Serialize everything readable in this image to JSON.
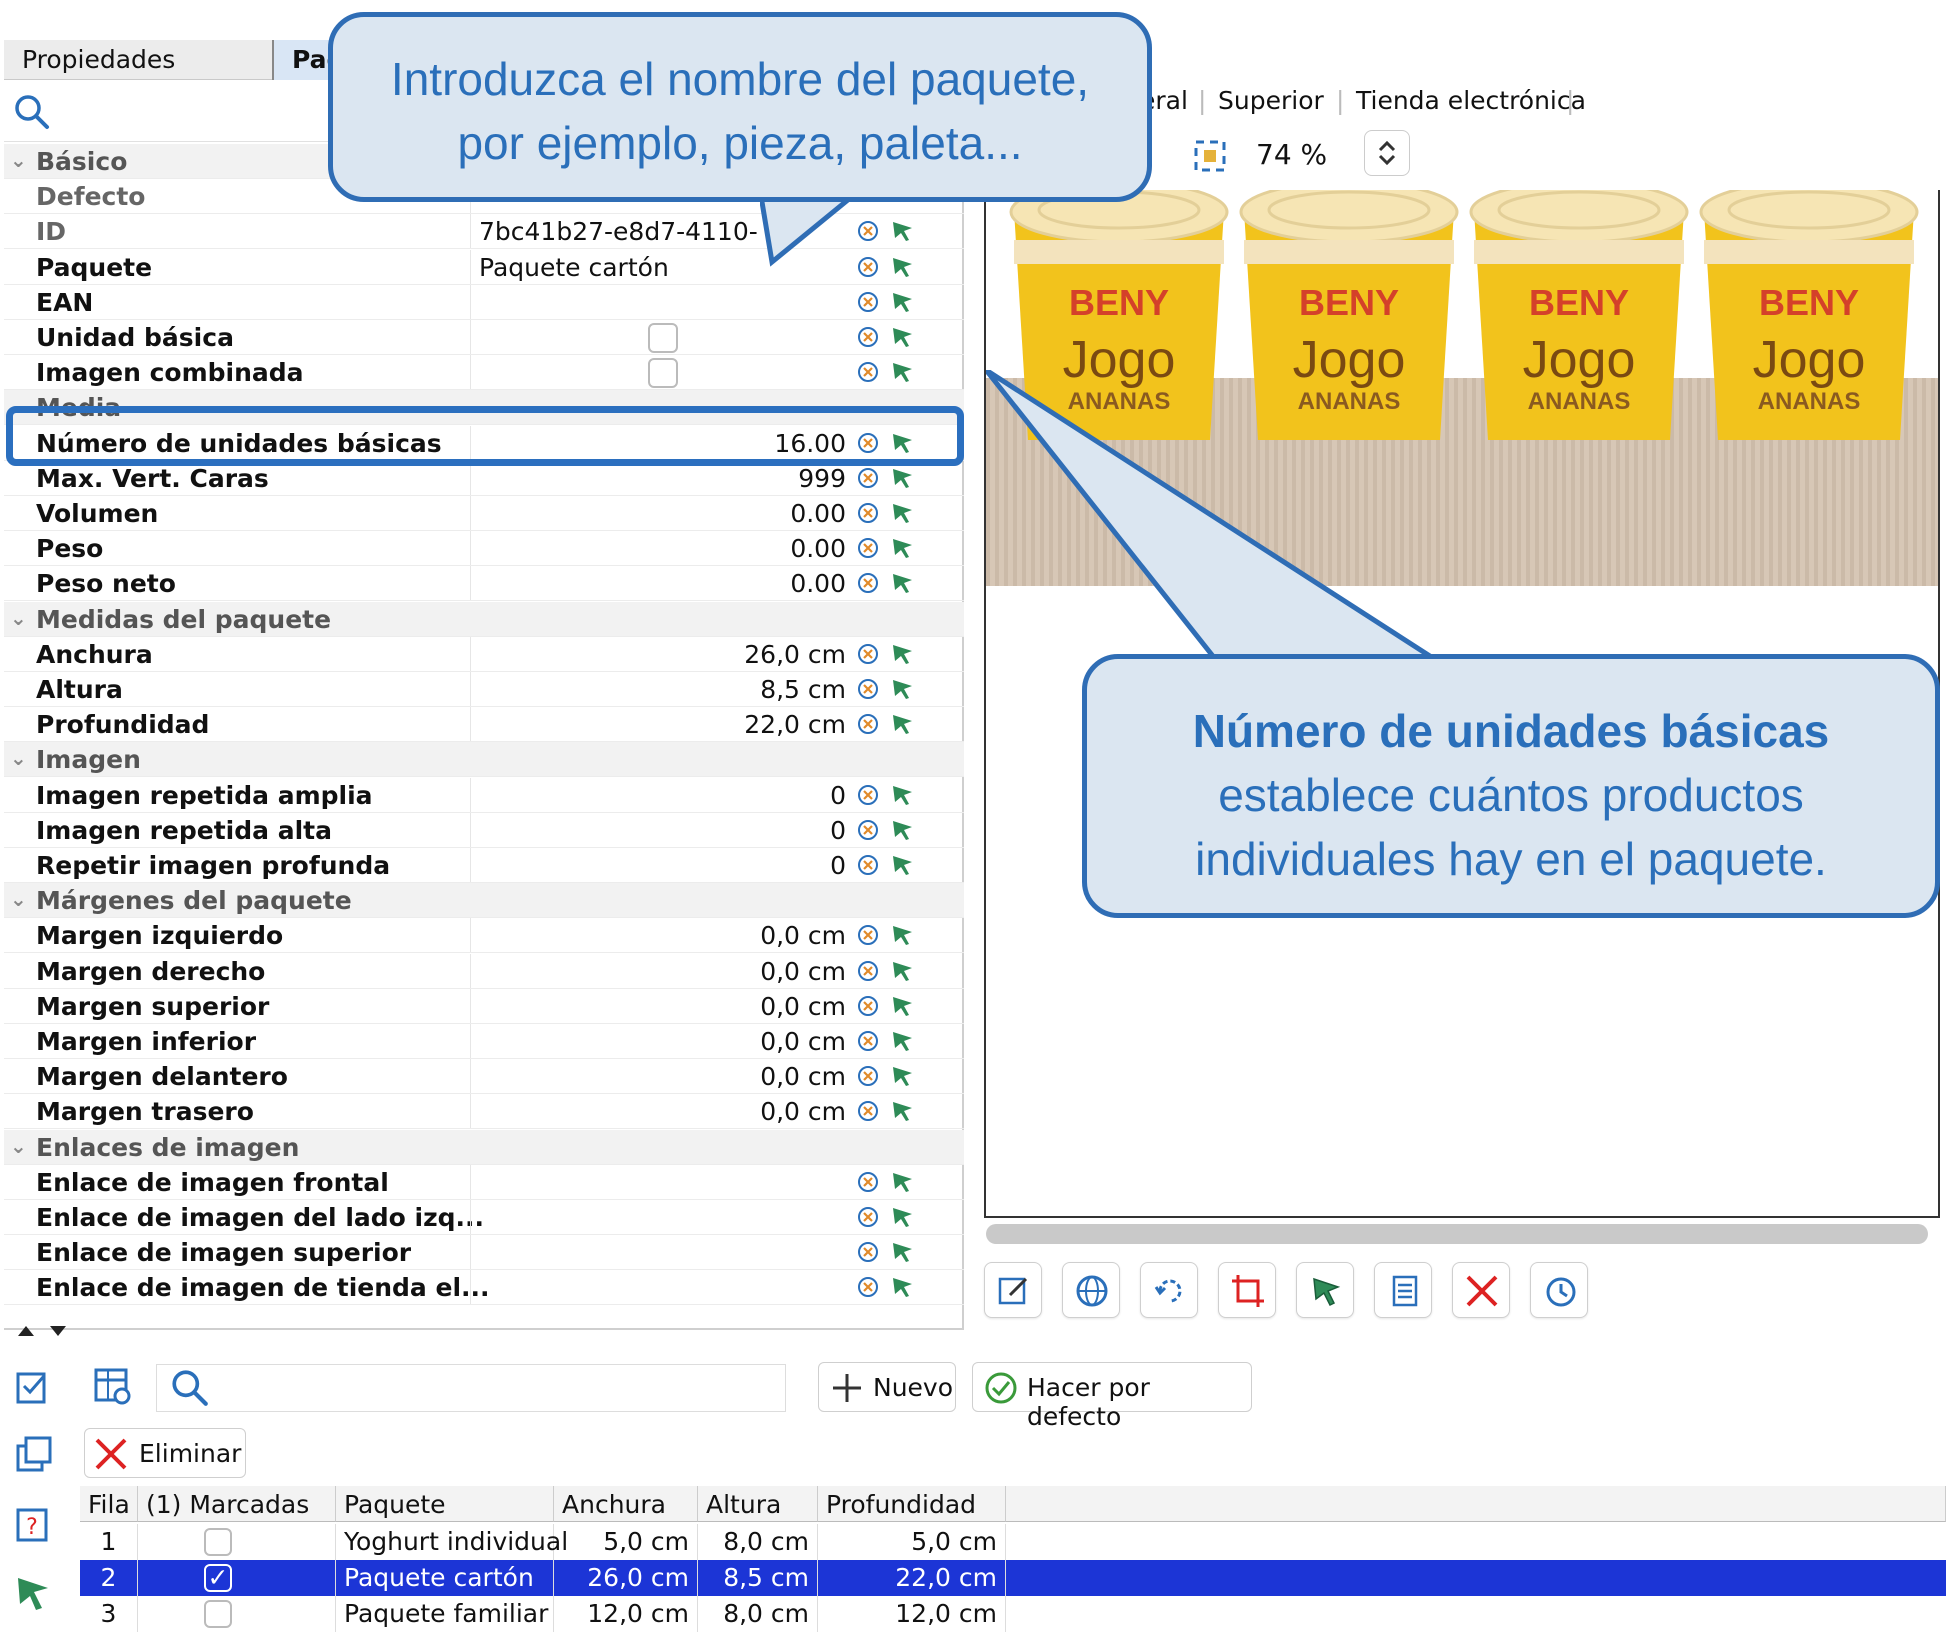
{
  "tabs": {
    "basic": "Propiedades básicas",
    "package": "Paq"
  },
  "properties": [
    {
      "kind": "group",
      "label": "Básico"
    },
    {
      "kind": "row",
      "label": "Defecto",
      "value": "",
      "disabled": true
    },
    {
      "kind": "row",
      "label": "ID",
      "value": "7bc41b27-e8d7-4110-",
      "disabled": true,
      "align": "left"
    },
    {
      "kind": "row",
      "label": "Paquete",
      "value": "Paquete cartón",
      "align": "left"
    },
    {
      "kind": "row",
      "label": "EAN",
      "value": ""
    },
    {
      "kind": "row",
      "label": "Unidad básica",
      "value": "",
      "checkbox": true
    },
    {
      "kind": "row",
      "label": "Imagen combinada",
      "value": "",
      "checkbox": true
    },
    {
      "kind": "group",
      "label": "Media"
    },
    {
      "kind": "row",
      "label": "Número de unidades básicas",
      "value": "16.00"
    },
    {
      "kind": "row",
      "label": "Max. Vert. Caras",
      "value": "999"
    },
    {
      "kind": "row",
      "label": "Volumen",
      "value": "0.00"
    },
    {
      "kind": "row",
      "label": "Peso",
      "value": "0.00"
    },
    {
      "kind": "row",
      "label": "Peso neto",
      "value": "0.00"
    },
    {
      "kind": "group",
      "label": "Medidas del paquete"
    },
    {
      "kind": "row",
      "label": "Anchura",
      "value": "26,0 cm"
    },
    {
      "kind": "row",
      "label": "Altura",
      "value": "8,5 cm"
    },
    {
      "kind": "row",
      "label": "Profundidad",
      "value": "22,0 cm"
    },
    {
      "kind": "group",
      "label": "Imagen"
    },
    {
      "kind": "row",
      "label": "Imagen repetida amplia",
      "value": "0"
    },
    {
      "kind": "row",
      "label": "Imagen repetida alta",
      "value": "0"
    },
    {
      "kind": "row",
      "label": "Repetir imagen profunda",
      "value": "0"
    },
    {
      "kind": "group",
      "label": "Márgenes del paquete"
    },
    {
      "kind": "row",
      "label": "Margen izquierdo",
      "value": "0,0 cm"
    },
    {
      "kind": "row",
      "label": "Margen derecho",
      "value": "0,0 cm"
    },
    {
      "kind": "row",
      "label": "Margen superior",
      "value": "0,0 cm"
    },
    {
      "kind": "row",
      "label": "Margen inferior",
      "value": "0,0 cm"
    },
    {
      "kind": "row",
      "label": "Margen delantero",
      "value": "0,0 cm"
    },
    {
      "kind": "row",
      "label": "Margen trasero",
      "value": "0,0 cm"
    },
    {
      "kind": "group",
      "label": "Enlaces de imagen"
    },
    {
      "kind": "row",
      "label": "Enlace de imagen frontal",
      "value": ""
    },
    {
      "kind": "row",
      "label": "Enlace de imagen del lado izq...",
      "value": ""
    },
    {
      "kind": "row",
      "label": "Enlace de imagen superior",
      "value": ""
    },
    {
      "kind": "row",
      "label": "Enlace de imagen de tienda el...",
      "value": ""
    }
  ],
  "view_tabs": [
    "eral",
    "Superior",
    "Tienda electrónica"
  ],
  "zoom": "74 %",
  "product": {
    "brand": "BENY",
    "name": "Jogo",
    "flavor": "ANANAS",
    "count": 4
  },
  "buttons": {
    "new": "Nuevo",
    "default": "Hacer por defecto",
    "delete": "Eliminar"
  },
  "table": {
    "headers": [
      "Fila",
      "(1) Marcadas",
      "Paquete",
      "Anchura",
      "Altura",
      "Profundidad"
    ],
    "rows": [
      {
        "fila": "1",
        "marked": false,
        "paquete": "Yoghurt individual",
        "anchura": "5,0 cm",
        "altura": "8,0 cm",
        "profundidad": "5,0 cm",
        "selected": false
      },
      {
        "fila": "2",
        "marked": true,
        "paquete": "Paquete cartón",
        "anchura": "26,0 cm",
        "altura": "8,5 cm",
        "profundidad": "22,0 cm",
        "selected": true
      },
      {
        "fila": "3",
        "marked": false,
        "paquete": "Paquete familiar",
        "anchura": "12,0 cm",
        "altura": "8,0 cm",
        "profundidad": "12,0 cm",
        "selected": false
      }
    ]
  },
  "callouts": {
    "top_line1": "Introduzca el nombre del paquete,",
    "top_line2": "por ejemplo, pieza, paleta...",
    "bottom_bold": "Número de unidades básicas",
    "bottom_line2": "establece cuántos productos",
    "bottom_line3": "individuales hay en el paquete."
  },
  "colors": {
    "accent": "#2f6db5",
    "callout_bg": "#dbe6f1",
    "selection": "#1c35d6"
  }
}
